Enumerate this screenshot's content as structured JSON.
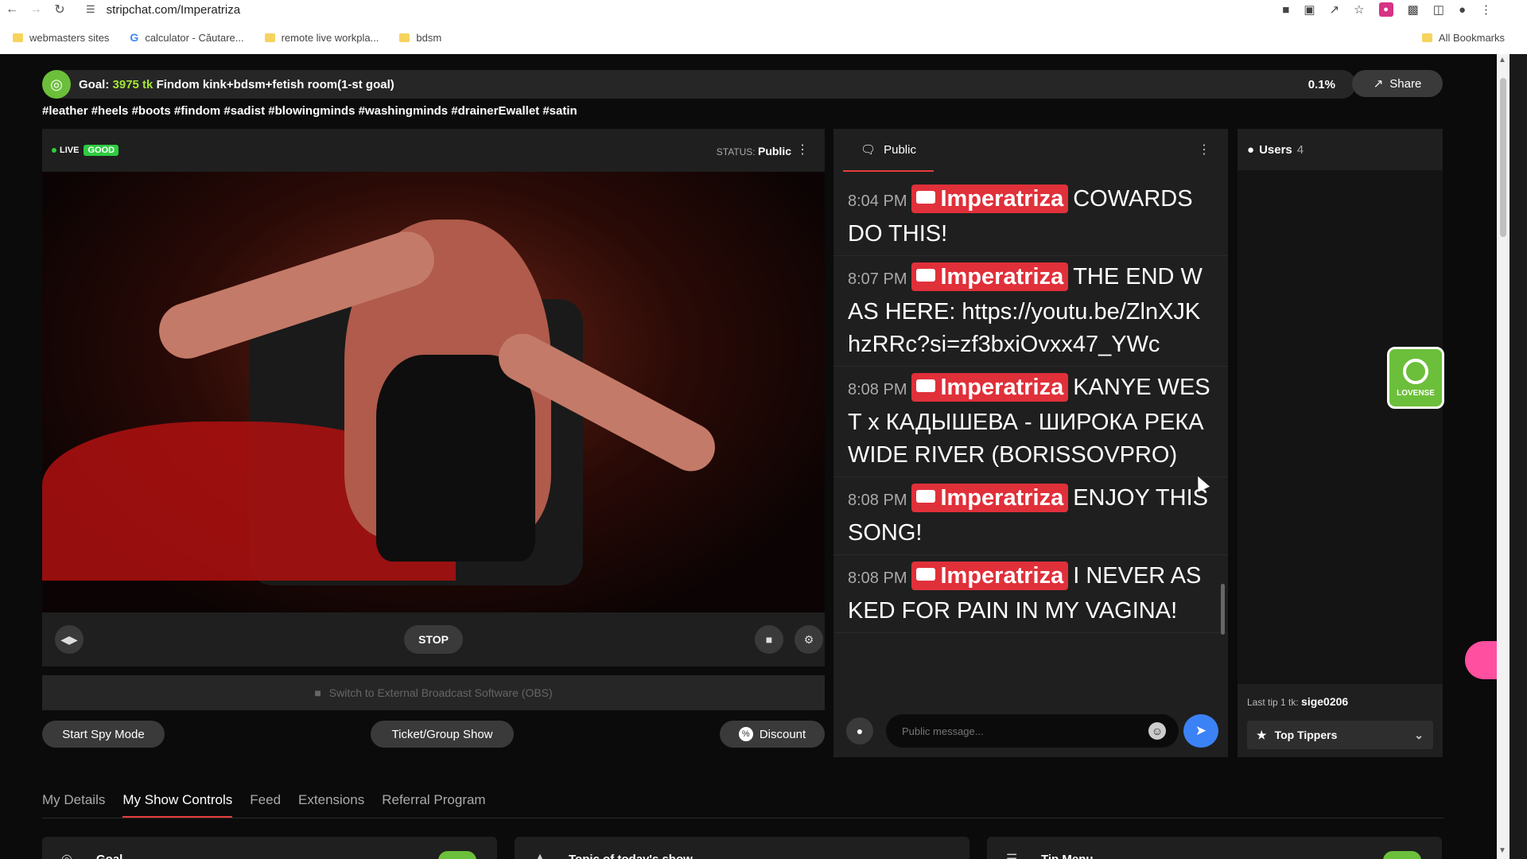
{
  "browser": {
    "url": "stripchat.com/Imperatriza",
    "bookmarks": [
      "webmasters sites",
      "calculator - Căutare...",
      "remote live workpla...",
      "bdsm"
    ],
    "all_bookmarks": "All Bookmarks"
  },
  "goal": {
    "label": "Goal:",
    "tokens": "3975 tk",
    "text": "Findom kink+bdsm+fetish room(1-st goal)",
    "percent": "0.1%"
  },
  "share_label": "Share",
  "tags": "#leather #heels #boots #findom #sadist #blowingminds #washingminds #drainerEwallet #satin",
  "video": {
    "live_label": "LIVE",
    "quality_label": "GOOD",
    "status_label": "STATUS:",
    "status_value": "Public",
    "stop_label": "STOP",
    "obs_label": "Switch to External Broadcast Software (OBS)"
  },
  "actions": {
    "spy_label": "Start Spy Mode",
    "ticket_label": "Ticket/Group Show",
    "discount_label": "Discount"
  },
  "chat": {
    "tab_label": "Public",
    "input_placeholder": "Public message...",
    "messages": [
      {
        "time": "8:04 PM",
        "user": "Imperatriza",
        "text": "COWARDS DO THIS!"
      },
      {
        "time": "8:07 PM",
        "user": "Imperatriza",
        "text": "THE END WAS HERE: https://youtu.be/ZlnXJKhzRRc?si=zf3bxiOvxx47_YWc"
      },
      {
        "time": "8:08 PM",
        "user": "Imperatriza",
        "text": "KANYE WEST x КАДЫШЕВА - ШИРОКА РЕКА WIDE RIVER (BORISSOVPRO)"
      },
      {
        "time": "8:08 PM",
        "user": "Imperatriza",
        "text": "ENJOY THIS SONG!"
      },
      {
        "time": "8:08 PM",
        "user": "Imperatriza",
        "text": "I NEVER ASKED FOR PAIN IN MY VAGINA!"
      }
    ]
  },
  "users": {
    "label": "Users",
    "count": "4",
    "last_tip_label": "Last tip 1 tk:",
    "last_tip_user": "sige0206",
    "top_tippers_label": "Top Tippers"
  },
  "lovense_label": "LOVENSE",
  "tabs": [
    "My Details",
    "My Show Controls",
    "Feed",
    "Extensions",
    "Referral Program"
  ],
  "active_tab": "My Show Controls",
  "cards": [
    {
      "title": "Goal"
    },
    {
      "title": "Topic of today's show"
    },
    {
      "title": "Tip Menu"
    }
  ]
}
